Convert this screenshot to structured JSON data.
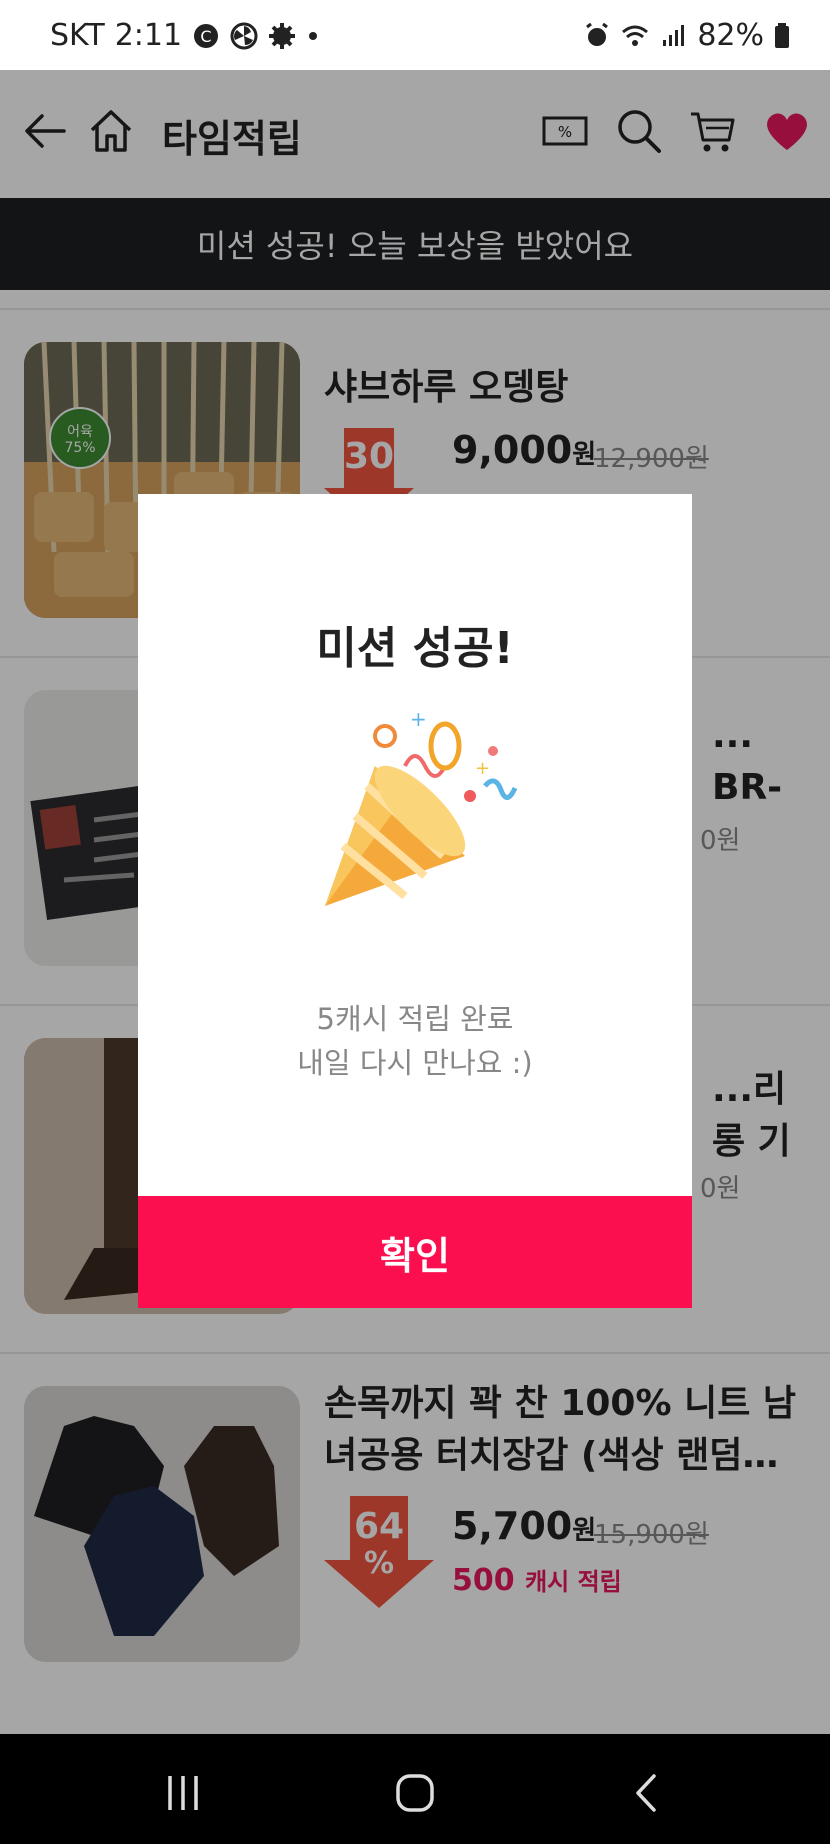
{
  "status_bar": {
    "carrier": "SKT",
    "time": "2:11",
    "battery": "82%"
  },
  "app_bar": {
    "title": "타임적립",
    "icons": [
      "back-arrow-icon",
      "home-icon",
      "coupon-icon",
      "search-icon",
      "cart-icon",
      "heart-icon"
    ]
  },
  "banner": {
    "text": "미션 성공! 오늘 보상을 받았어요"
  },
  "products": [
    {
      "name": "샤브하루 오뎅탕",
      "discount": "30",
      "price": "9,000",
      "currency": "원",
      "original_price": "12,900원",
      "thumb_badge": "어육 75%"
    },
    {
      "name": "... BR-",
      "original_price_tail": "0원"
    },
    {
      "name": "...리 롱 기",
      "original_price_tail": "0원"
    },
    {
      "name": "손목까지 꽉 찬 100% 니트 남녀공용 터치장갑 (색상 랜덤…",
      "discount": "64",
      "discount_unit": "%",
      "price": "5,700",
      "currency": "원",
      "original_price": "15,900원",
      "cash_amount": "500",
      "cash_label": "캐시 적립"
    }
  ],
  "dialog": {
    "title": "미션 성공!",
    "line1": "5캐시 적립 완료",
    "line2": "내일 다시 만나요 :)",
    "confirm_label": "확인",
    "icon": "party-popper-icon"
  },
  "colors": {
    "accent": "#fb0f4f",
    "banner_bg": "#1e1f21",
    "cash_text": "#e8175d",
    "discount": "#f05540"
  }
}
